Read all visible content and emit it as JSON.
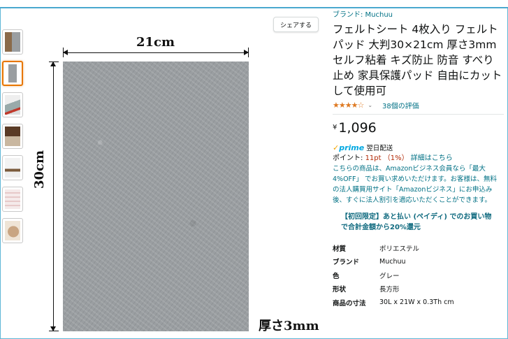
{
  "share": {
    "label": "シェアする"
  },
  "image": {
    "width_label": "21cm",
    "height_label": "30cm",
    "thickness_label": "厚さ3mm"
  },
  "thumbnails": [
    {
      "name": "thumb-1",
      "selected": false
    },
    {
      "name": "thumb-2",
      "selected": true
    },
    {
      "name": "thumb-3",
      "selected": false
    },
    {
      "name": "thumb-4",
      "selected": false
    },
    {
      "name": "thumb-5",
      "selected": false
    },
    {
      "name": "thumb-6",
      "selected": false
    },
    {
      "name": "thumb-7",
      "selected": false
    }
  ],
  "product": {
    "brand": "ブランド: Muchuu",
    "title": "フェルトシート 4枚入り フェルトパッド 大判30×21cm 厚さ3mm セルフ粘着 キズ防止 防音 すべり止め 家具保護パッド 自由にカットして使用可",
    "stars": "★★★★☆",
    "review_count": "38個の評価",
    "price_currency": "¥",
    "price_amount": "1,096",
    "prime_label": "prime",
    "delivery": "翌日配送",
    "points_label": "ポイント: ",
    "points_value": "11pt （1%）",
    "points_link": "詳細はこちら",
    "business_note": "こちらの商品は、Amazonビジネス会員なら「最大4%OFF」 でお買い求めいただけます。お客様は、無料の法人購買用サイト「Amazonビジネス」にお申込み後、すぐに法人割引を適応いただくことができます。",
    "promo": "【初回限定】あと払い (ペイディ) でのお買い物で合計金額から20%還元"
  },
  "specs": [
    {
      "key": "材質",
      "value": "ポリエステル"
    },
    {
      "key": "ブランド",
      "value": "Muchuu"
    },
    {
      "key": "色",
      "value": "グレー"
    },
    {
      "key": "形状",
      "value": "長方形"
    },
    {
      "key": "商品の寸法",
      "value": "30L x 21W x 0.3Th cm"
    }
  ],
  "colors": {
    "accent": "#e77600",
    "link": "#007185",
    "price_red": "#b12704",
    "prime": "#00a8e1"
  }
}
